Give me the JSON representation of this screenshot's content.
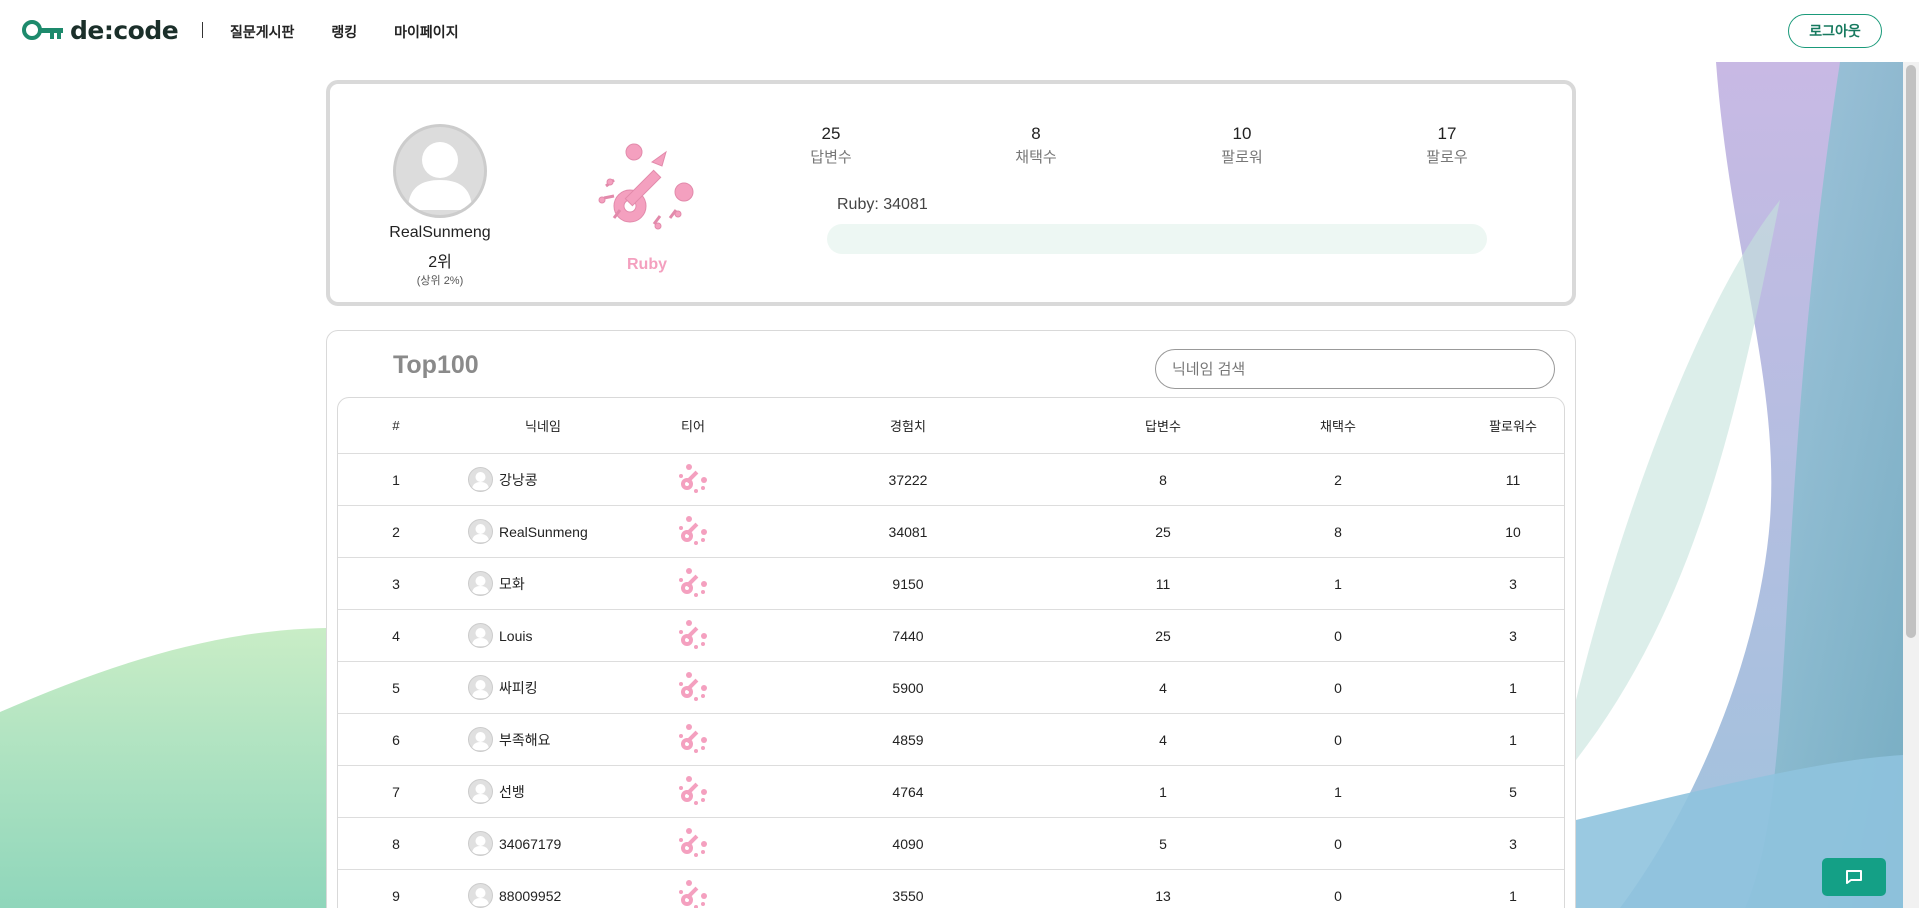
{
  "header": {
    "logo_text": "de:code",
    "nav": [
      "질문게시판",
      "랭킹",
      "마이페이지"
    ],
    "logout_label": "로그아웃"
  },
  "profile": {
    "name": "RealSunmeng",
    "rank": "2위",
    "percent": "(상위 2%)",
    "tier": "Ruby",
    "stats": [
      {
        "value": "25",
        "label": "답변수"
      },
      {
        "value": "8",
        "label": "채택수"
      },
      {
        "value": "10",
        "label": "팔로워"
      },
      {
        "value": "17",
        "label": "팔로우"
      }
    ],
    "exp_text": "Ruby: 34081"
  },
  "ranking": {
    "title": "Top100",
    "search_placeholder": "닉네임 검색",
    "columns": [
      "#",
      "닉네임",
      "티어",
      "경험치",
      "답변수",
      "채택수",
      "팔로워수"
    ],
    "rows": [
      {
        "rank": "1",
        "nickname": "강낭콩",
        "xp": "37222",
        "answers": "8",
        "selected": "2",
        "followers": "11"
      },
      {
        "rank": "2",
        "nickname": "RealSunmeng",
        "xp": "34081",
        "answers": "25",
        "selected": "8",
        "followers": "10"
      },
      {
        "rank": "3",
        "nickname": "모화",
        "xp": "9150",
        "answers": "11",
        "selected": "1",
        "followers": "3"
      },
      {
        "rank": "4",
        "nickname": "Louis",
        "xp": "7440",
        "answers": "25",
        "selected": "0",
        "followers": "3"
      },
      {
        "rank": "5",
        "nickname": "싸피킹",
        "xp": "5900",
        "answers": "4",
        "selected": "0",
        "followers": "1"
      },
      {
        "rank": "6",
        "nickname": "부족해요",
        "xp": "4859",
        "answers": "4",
        "selected": "0",
        "followers": "1"
      },
      {
        "rank": "7",
        "nickname": "선뱅",
        "xp": "4764",
        "answers": "1",
        "selected": "1",
        "followers": "5"
      },
      {
        "rank": "8",
        "nickname": "34067179",
        "xp": "4090",
        "answers": "5",
        "selected": "0",
        "followers": "3"
      },
      {
        "rank": "9",
        "nickname": "88009952",
        "xp": "3550",
        "answers": "13",
        "selected": "0",
        "followers": "1"
      }
    ]
  },
  "icons": {
    "logo": "key-logo-icon",
    "tier": "ruby-key-emblem-icon",
    "chat": "chat-icon"
  },
  "colors": {
    "accent": "#14a086",
    "tier_ruby": "#f4a0bf",
    "progress_track": "#edf7f3"
  }
}
